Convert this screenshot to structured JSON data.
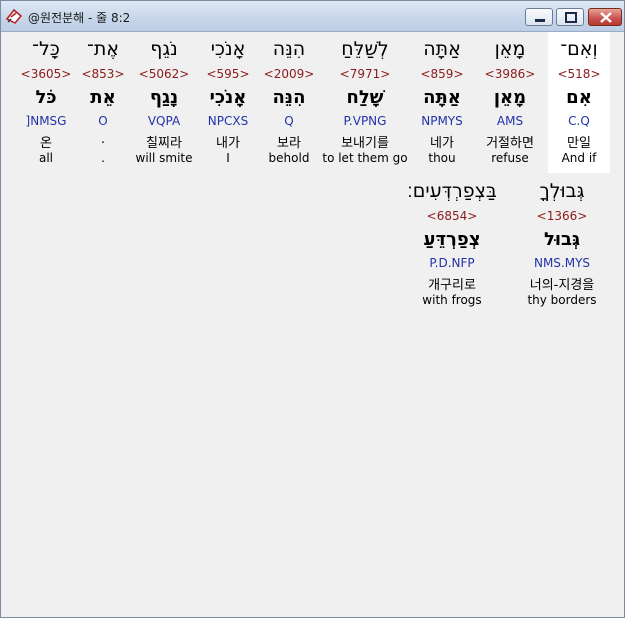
{
  "window": {
    "title": "@원전분해 - 줄 8:2"
  },
  "rows": [
    {
      "words": [
        {
          "hebrew": "וְאִם־",
          "strong": "<518>",
          "lemma": "אִם",
          "morph": "C.Q",
          "korean": "만일",
          "english": "And if"
        },
        {
          "hebrew": "מָאֵן",
          "strong": "<3986>",
          "lemma": "מָאֵן",
          "morph": "AMS",
          "korean": "거절하면",
          "english": "refuse"
        },
        {
          "hebrew": "אַתָּה",
          "strong": "<859>",
          "lemma": "אַתָּה",
          "morph": "NPMYS",
          "korean": "네가",
          "english": "thou"
        },
        {
          "hebrew": "לְשַׁלֵּחַ",
          "strong": "<7971>",
          "lemma": "שָׁלַח",
          "morph": "P.VPNG",
          "korean": "보내기를",
          "english": "to let them go"
        },
        {
          "hebrew": "הִנֵּה",
          "strong": "<2009>",
          "lemma": "הִנֵּה",
          "morph": "Q",
          "korean": "보라",
          "english": "behold"
        },
        {
          "hebrew": "אָנֹכִי",
          "strong": "<595>",
          "lemma": "אָנֹכִי",
          "morph": "NPCXS",
          "korean": "내가",
          "english": "I"
        },
        {
          "hebrew": "נֹגֵף",
          "strong": "<5062>",
          "lemma": "נָגַף",
          "morph": "VQPA",
          "korean": "칠찌라",
          "english": "will smite"
        },
        {
          "hebrew": "אֶת־",
          "strong": "<853>",
          "lemma": "אֵת",
          "morph": "O",
          "korean": ".",
          "english": "."
        },
        {
          "hebrew": "כָּל־",
          "strong": "<3605>",
          "lemma": "כֹּל",
          "morph": "]NMSG",
          "korean": "온",
          "english": "all"
        }
      ]
    },
    {
      "words": [
        {
          "hebrew": "גְּבוּלְךָ",
          "strong": "<1366>",
          "lemma": "גְּבוּל",
          "morph": "NMS.MYS",
          "korean": "너의-지경을",
          "english": "thy borders"
        },
        {
          "hebrew": "בַּצְפַרְדְּעִים׃",
          "strong": "<6854>",
          "lemma": "צְפַרְדֵּעַ",
          "morph": "P.D.NFP",
          "korean": "개구리로",
          "english": "with frogs"
        }
      ]
    }
  ]
}
